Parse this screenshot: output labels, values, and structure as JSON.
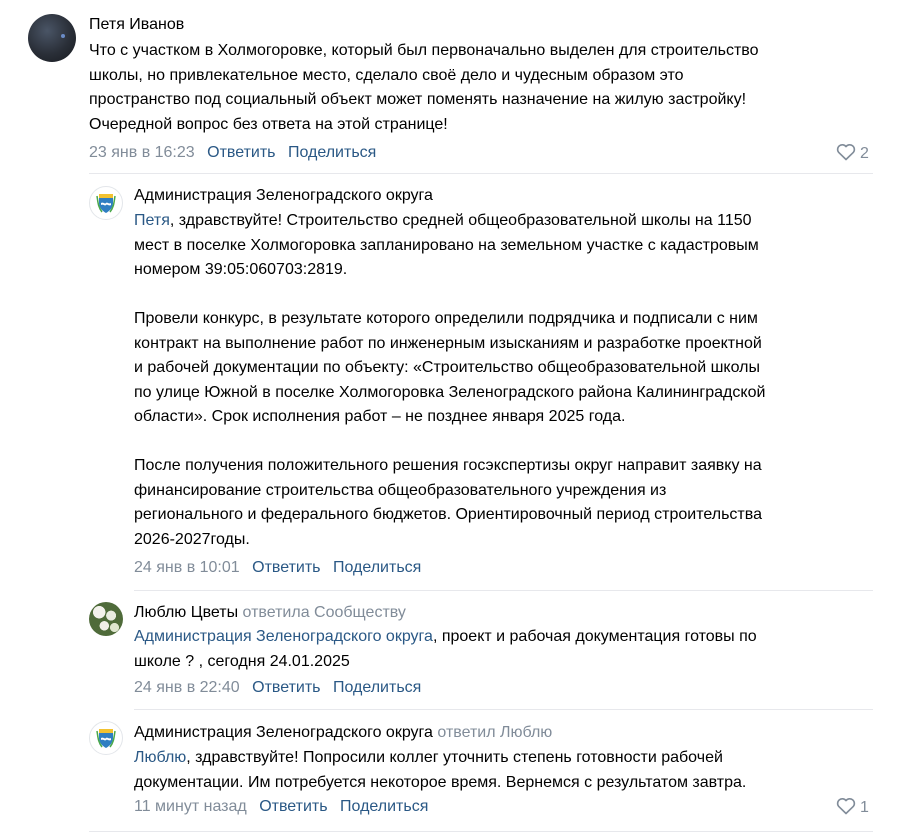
{
  "comments": [
    {
      "author": "Петя Иванов",
      "text_lines": [
        "Что с участком в Холмогоровке, который был первоначально выделен для строительство",
        "школы, но привлекательное место, сделало своё дело и чудесным образом это",
        "пространство под социальный объект может поменять назначение на жилую застройку!",
        "Очередной вопрос без ответа на этой странице!"
      ],
      "date": "23 янв в 16:23",
      "reply": "Ответить",
      "share": "Поделиться",
      "likes": "2"
    },
    {
      "author": "Администрация Зеленоградского округа",
      "mention": "Петя",
      "text_lines": [
        ", здравствуйте! Строительство средней общеобразовательной школы на 1150",
        "мест в поселке Холмогоровка запланировано на земельном участке с кадастровым",
        "номером 39:05:060703:2819.",
        "",
        "Провели конкурс, в результате которого определили подрядчика и подписали с ним",
        "контракт на выполнение работ по инженерным изысканиям и разработке проектной",
        "и рабочей документации по объекту: «Строительство общеобразовательной школы",
        "по улице Южной в поселке Холмогоровка Зеленоградского района Калининградской",
        "области». Срок исполнения работ – не позднее января 2025 года.",
        "",
        "После получения положительного решения госэкспертизы округ направит заявку на",
        "финансирование строительства общеобразовательного учреждения из",
        "регионального и федерального бюджетов. Ориентировочный период строительства",
        "2026-2027годы."
      ],
      "date": "24 янв в 10:01",
      "reply": "Ответить",
      "share": "Поделиться"
    },
    {
      "author": "Люблю Цветы",
      "replied_to": "ответила Сообществу",
      "mention": "Администрация Зеленоградского округа",
      "text_lines": [
        ", проект и рабочая документация готовы по",
        "школе ? , сегодня 24.01.2025"
      ],
      "date": "24 янв в 22:40",
      "reply": "Ответить",
      "share": "Поделиться"
    },
    {
      "author": "Администрация Зеленоградского округа",
      "replied_to": "ответил Люблю",
      "mention": "Люблю",
      "text_lines": [
        ", здравствуйте! Попросили коллег уточнить степень готовности рабочей",
        "документации. Им потребуется некоторое время. Вернемся с результатом завтра."
      ],
      "date": "11 минут назад",
      "reply": "Ответить",
      "share": "Поделиться",
      "likes": "1"
    }
  ],
  "icons": {
    "like": "heart-outline-icon",
    "admin_avatar": "coat-of-arms-icon"
  },
  "colors": {
    "link": "#2a5885",
    "secondary": "#818c99",
    "divider": "#e7e8ec"
  }
}
